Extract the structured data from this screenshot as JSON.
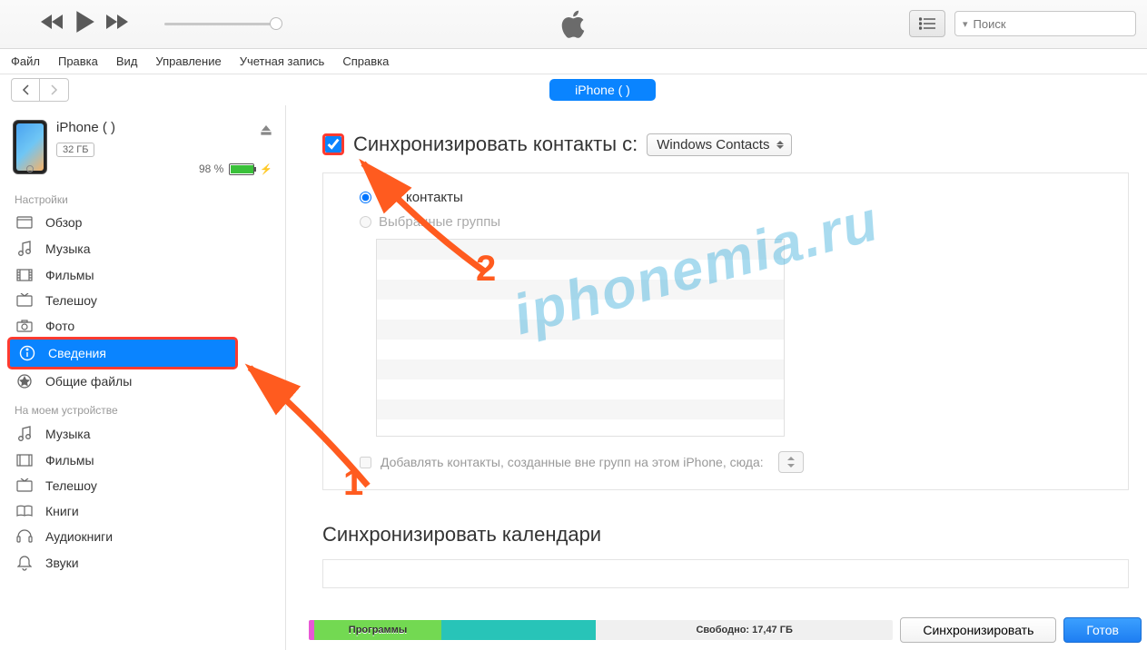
{
  "menu": [
    "Файл",
    "Правка",
    "Вид",
    "Управление",
    "Учетная запись",
    "Справка"
  ],
  "search_placeholder": "Поиск",
  "device_pill": "iPhone (         )",
  "device": {
    "name": "iPhone (         )",
    "capacity": "32 ГБ",
    "battery_pct": "98 %"
  },
  "sidebar": {
    "settings_title": "Настройки",
    "settings_items": [
      "Обзор",
      "Музыка",
      "Фильмы",
      "Телешоу",
      "Фото",
      "Сведения",
      "Общие файлы"
    ],
    "device_title": "На моем устройстве",
    "device_items": [
      "Музыка",
      "Фильмы",
      "Телешоу",
      "Книги",
      "Аудиокниги",
      "Звуки"
    ]
  },
  "content": {
    "sync_contacts_label": "Синхронизировать контакты с:",
    "sync_source": "Windows Contacts",
    "radio_all": "Все контакты",
    "radio_groups": "Выбранные группы",
    "add_outside_label": "Добавлять контакты, созданные вне групп на этом iPhone, сюда:",
    "sync_calendars": "Синхронизировать календари"
  },
  "bottom": {
    "apps_label": "Программы",
    "free_label": "Свободно: 17,47 ГБ",
    "sync_btn": "Синхронизировать",
    "done_btn": "Готов"
  },
  "watermark": "iphonemia.ru",
  "anno": {
    "n1": "1",
    "n2": "2"
  }
}
